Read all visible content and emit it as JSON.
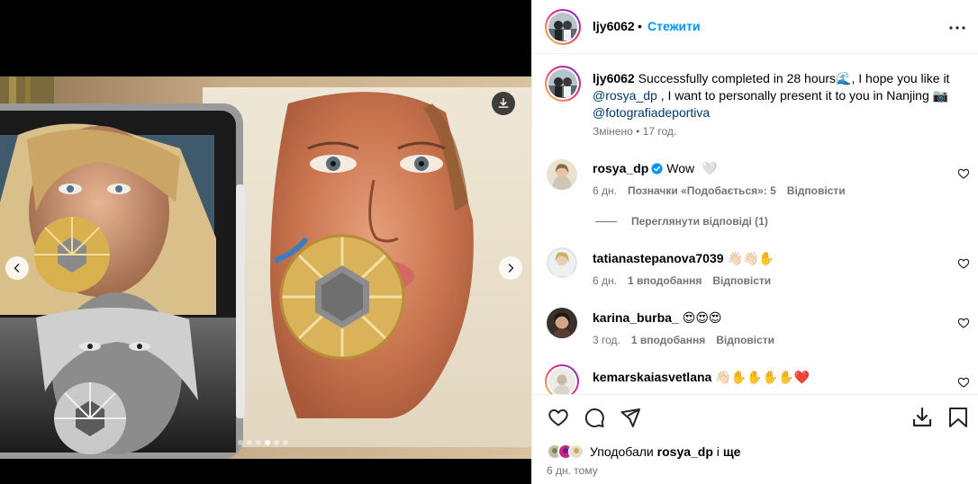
{
  "post": {
    "author": "ljy6062",
    "separator": "•",
    "follow_label": "Стежити",
    "more_icon": "more-horizontal-icon"
  },
  "media": {
    "download_icon": "download-icon",
    "prev_icon": "chevron-left-icon",
    "next_icon": "chevron-right-icon",
    "slide_count": 6,
    "active_slide": 3
  },
  "caption": {
    "username": "ljy6062",
    "text_part1": "Successfully completed in 28 hours",
    "emoji1": "🌊",
    "text_part2": ", I hope you like it",
    "mention1": "@rosya_dp",
    "text_part3": ", I want to personally present it to you in Nanjing",
    "emoji_camera": "📷",
    "mention2": "@fotografiadeportiva",
    "edited": "Змінено",
    "time": "17 год."
  },
  "comments": [
    {
      "username": "rosya_dp",
      "verified": true,
      "text": "Wow",
      "emoji": "🤍",
      "time": "6 дн.",
      "likes_label": "Позначки «Подобається»: 5",
      "reply_label": "Відповісти",
      "view_replies": "Переглянути відповіді (1)"
    },
    {
      "username": "tatianastepanova7039",
      "text": "👋🏻👋🏻✋",
      "time": "6 дн.",
      "likes_label": "1 вподобання",
      "reply_label": "Відповісти"
    },
    {
      "username": "karina_burba_",
      "text": "😍😍😍",
      "time": "3 год.",
      "likes_label": "1 вподобання",
      "reply_label": "Відповісти"
    },
    {
      "username": "kemarskaiasvetlana",
      "text": "👋🏻✋✋✋✋❤️"
    }
  ],
  "footer": {
    "liked_by_prefix": "Уподобали",
    "liked_by_user": "rosya_dp",
    "liked_by_joiner": "і",
    "liked_by_suffix": "ще",
    "date": "6 дн. тому"
  },
  "colors": {
    "accent": "#0095f6",
    "mention": "#00376b",
    "muted": "#737373",
    "verified": "#0095f6",
    "heart_red": "#d32f2f"
  }
}
